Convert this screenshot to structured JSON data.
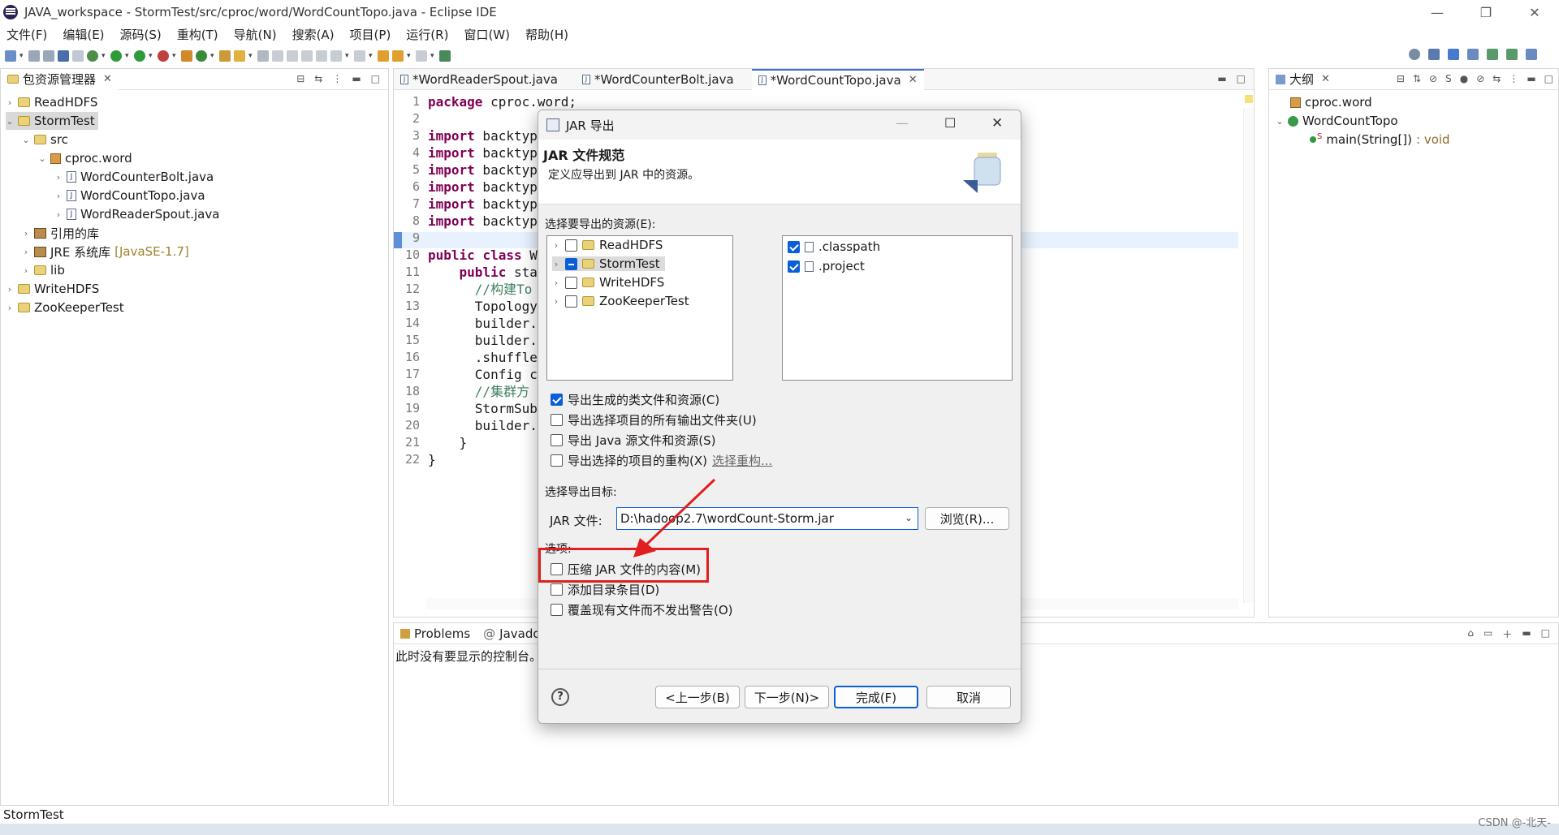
{
  "window": {
    "title": "JAVA_workspace - StormTest/src/cproc/word/WordCountTopo.java - Eclipse IDE",
    "minimize": "—",
    "restore": "❐",
    "close": "✕"
  },
  "menu": [
    "文件(F)",
    "编辑(E)",
    "源码(S)",
    "重构(T)",
    "导航(N)",
    "搜索(A)",
    "项目(P)",
    "运行(R)",
    "窗口(W)",
    "帮助(H)"
  ],
  "package_explorer": {
    "tab_label": "包资源管理器",
    "items": [
      {
        "label": "ReadHDFS"
      },
      {
        "label": "StormTest"
      },
      {
        "label": "src"
      },
      {
        "label": "cproc.word"
      },
      {
        "label": "WordCounterBolt.java"
      },
      {
        "label": "WordCountTopo.java"
      },
      {
        "label": "WordReaderSpout.java"
      },
      {
        "label": "引用的库"
      },
      {
        "label": "JRE 系统库",
        "suffix": "[JavaSE-1.7]"
      },
      {
        "label": "lib"
      },
      {
        "label": "WriteHDFS"
      },
      {
        "label": "ZooKeeperTest"
      }
    ]
  },
  "editor": {
    "tabs": [
      "*WordReaderSpout.java",
      "*WordCounterBolt.java",
      "*WordCountTopo.java"
    ],
    "lines": [
      {
        "n": "1",
        "text": "package cproc.word;"
      },
      {
        "n": "2",
        "text": ""
      },
      {
        "n": "3",
        "text": "import backtyp"
      },
      {
        "n": "4",
        "text": "import backtyp"
      },
      {
        "n": "5",
        "text": "import backtyp"
      },
      {
        "n": "6",
        "text": "import backtyp"
      },
      {
        "n": "7",
        "text": "import backtyp"
      },
      {
        "n": "8",
        "text": "import backtyp"
      },
      {
        "n": "9",
        "text": ""
      },
      {
        "n": "10",
        "text": "public class W"
      },
      {
        "n": "11",
        "text": "    public sta"
      },
      {
        "n": "12",
        "text": "      //构建To"
      },
      {
        "n": "13",
        "text": "      Topology"
      },
      {
        "n": "14",
        "text": "      builder."
      },
      {
        "n": "15",
        "text": "      builder."
      },
      {
        "n": "16",
        "text": "      .shuffle"
      },
      {
        "n": "17",
        "text": "      Config c"
      },
      {
        "n": "18",
        "text": "      //集群方"
      },
      {
        "n": "19",
        "text": "      StormSub"
      },
      {
        "n": "20",
        "text": "      builder."
      },
      {
        "n": "21",
        "text": "    }"
      },
      {
        "n": "22",
        "text": "}"
      }
    ]
  },
  "outline": {
    "tab_label": "大纲",
    "items": [
      {
        "label": "cproc.word"
      },
      {
        "label": "WordCountTopo"
      },
      {
        "label": "main(String[])",
        "suffix": ": void"
      }
    ]
  },
  "bottom_panel": {
    "tabs": [
      "Problems",
      "Javadoc"
    ],
    "message": "此时没有要显示的控制台。"
  },
  "status": "StormTest",
  "watermark": "CSDN @-北天-",
  "dialog": {
    "title": "JAR 导出",
    "header_title": "JAR 文件规范",
    "header_desc": "定义应导出到 JAR 中的资源。",
    "resources_label": "选择要导出的资源(E):",
    "projects": [
      {
        "label": "ReadHDFS",
        "state": "off"
      },
      {
        "label": "StormTest",
        "state": "mixed"
      },
      {
        "label": "WriteHDFS",
        "state": "off"
      },
      {
        "label": "ZooKeeperTest",
        "state": "off"
      }
    ],
    "files": [
      {
        "label": ".classpath",
        "state": "on"
      },
      {
        "label": ".project",
        "state": "on"
      }
    ],
    "export_options": [
      {
        "label": "导出生成的类文件和资源(C)",
        "state": "on"
      },
      {
        "label": "导出选择项目的所有输出文件夹(U)",
        "state": "off"
      },
      {
        "label": "导出 Java 源文件和资源(S)",
        "state": "off"
      },
      {
        "label": "导出选择的项目的重构(X)",
        "state": "off",
        "link": "选择重构..."
      }
    ],
    "dest_label": "选择导出目标:",
    "jar_label": "JAR 文件:",
    "jar_value": "D:\\hadoop2.7\\wordCount-Storm.jar",
    "browse": "浏览(R)...",
    "options_label": "选项:",
    "options": [
      {
        "label": "压缩 JAR 文件的内容(M)",
        "state": "off"
      },
      {
        "label": "添加目录条目(D)",
        "state": "off"
      },
      {
        "label": "覆盖现有文件而不发出警告(O)",
        "state": "off"
      }
    ],
    "buttons": {
      "back": "<上一步(B)",
      "next": "下一步(N)>",
      "finish": "完成(F)",
      "cancel": "取消"
    },
    "help": "?"
  },
  "colors": {
    "accent": "#0b5ed7",
    "annotation_red": "#e02020"
  }
}
